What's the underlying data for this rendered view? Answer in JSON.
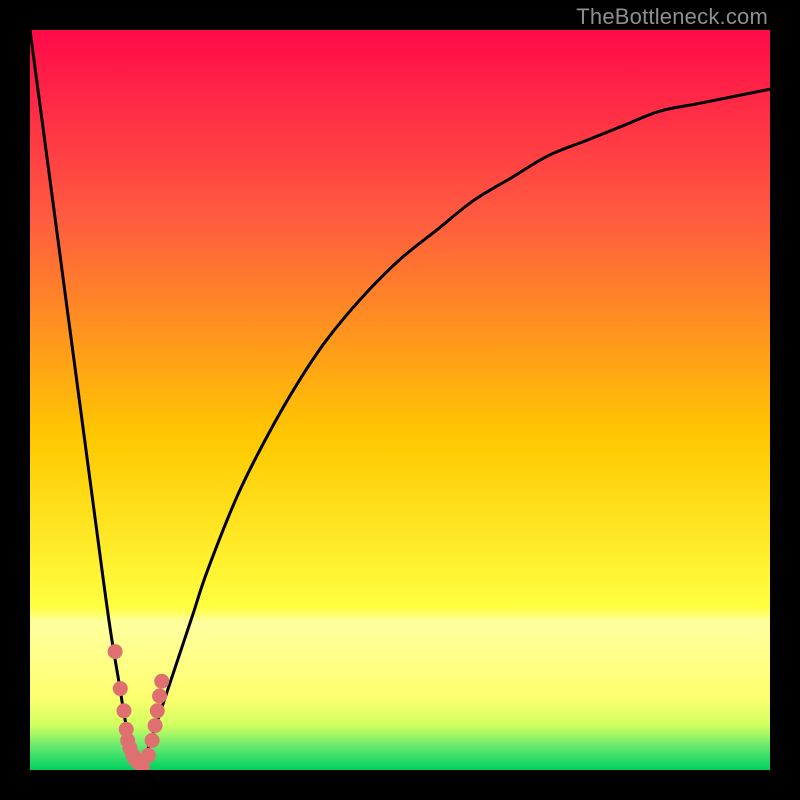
{
  "watermark": {
    "text": "TheBottleneck.com"
  },
  "chart_data": {
    "type": "line",
    "title": "",
    "xlabel": "",
    "ylabel": "",
    "xlim": [
      0,
      100
    ],
    "ylim": [
      0,
      100
    ],
    "grid": false,
    "series": [
      {
        "name": "bottleneck-curve",
        "x": [
          0,
          2,
          4,
          6,
          8,
          10,
          11,
          12,
          13,
          14,
          15,
          16,
          18,
          20,
          22,
          24,
          28,
          32,
          36,
          40,
          45,
          50,
          55,
          60,
          65,
          70,
          75,
          80,
          85,
          90,
          95,
          100
        ],
        "values": [
          100,
          85,
          70,
          55,
          40,
          25,
          18,
          12,
          6,
          2,
          0,
          3,
          9,
          15,
          21,
          27,
          37,
          45,
          52,
          58,
          64,
          69,
          73,
          77,
          80,
          83,
          85,
          87,
          89,
          90,
          91,
          92
        ]
      }
    ],
    "markers": {
      "name": "dots",
      "color": "#e07070",
      "x": [
        11.5,
        12.2,
        12.7,
        13.0,
        13.2,
        13.5,
        13.9,
        14.2,
        14.6,
        15.2,
        16.0,
        16.5,
        16.9,
        17.2,
        17.5,
        17.8
      ],
      "values": [
        16,
        11,
        8,
        5.5,
        4,
        3,
        2,
        1.5,
        1,
        0.5,
        2,
        4,
        6,
        8,
        10,
        12
      ]
    },
    "background_gradient": {
      "stops": [
        {
          "pos": 0.0,
          "color": "#ff0a4a"
        },
        {
          "pos": 0.25,
          "color": "#ff5a40"
        },
        {
          "pos": 0.55,
          "color": "#ffc800"
        },
        {
          "pos": 0.78,
          "color": "#ffff40"
        },
        {
          "pos": 0.8,
          "color": "#ffffa0"
        },
        {
          "pos": 0.9,
          "color": "#ffff70"
        },
        {
          "pos": 0.94,
          "color": "#d0ff60"
        },
        {
          "pos": 0.97,
          "color": "#60e870"
        },
        {
          "pos": 1.0,
          "color": "#00d060"
        }
      ]
    }
  }
}
